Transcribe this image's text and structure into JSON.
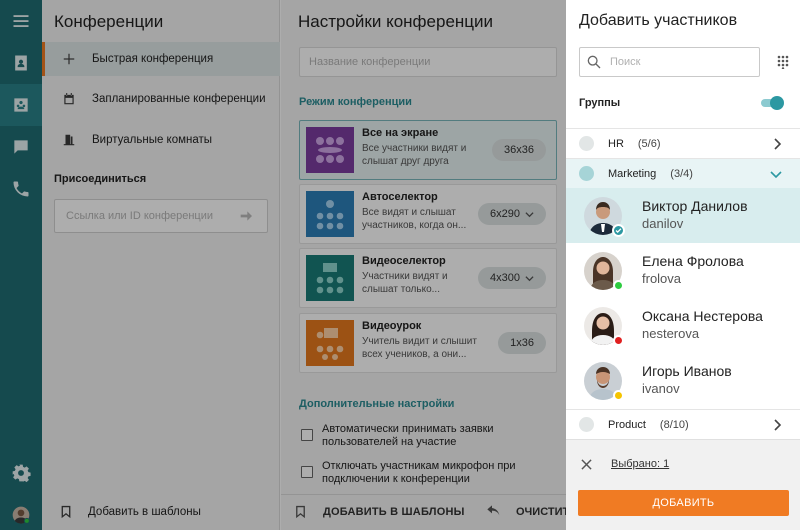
{
  "colors": {
    "rail": "#1f6d74",
    "accent_orange": "#f07b23",
    "teal": "#2c98a2",
    "online": "#2ecc40",
    "busy": "#e02020",
    "away": "#f5c400"
  },
  "rail": {
    "icons": [
      "menu-icon",
      "contacts-icon",
      "conference-icon",
      "chat-icon",
      "phone-icon",
      "settings-icon",
      "user-avatar"
    ]
  },
  "conferences": {
    "title": "Конференции",
    "items": [
      {
        "label": "Быстрая конференция",
        "icon": "plus-icon"
      },
      {
        "label": "Запланированные конференции",
        "icon": "calendar-icon"
      },
      {
        "label": "Виртуальные комнаты",
        "icon": "door-icon"
      }
    ],
    "join_label": "Присоединиться",
    "join_placeholder": "Ссылка или ID конференции",
    "footer_label": "Добавить в шаблоны"
  },
  "settings": {
    "title": "Настройки конференции",
    "name_placeholder": "Название конференции",
    "mode_label": "Режим конференции",
    "modes": [
      {
        "name": "Все на экране",
        "desc": "Все участники видят и слышат друг друга",
        "value": "36x36",
        "dropdown": false
      },
      {
        "name": "Автоселектор",
        "desc": "Все видят и слышат участников, когда он...",
        "value": "6x290",
        "dropdown": true
      },
      {
        "name": "Видеоселектор",
        "desc": "Участники видят и слышат только...",
        "value": "4x300",
        "dropdown": true
      },
      {
        "name": "Видеоурок",
        "desc": "Учитель видит и слышит всех учеников, а они...",
        "value": "1x36",
        "dropdown": false
      }
    ],
    "extra_label": "Дополнительные настройки",
    "options": [
      "Автоматически принимать заявки пользователей на участие",
      "Отключать участникам микрофон при подключении к конференции"
    ],
    "footer_add": "ДОБАВИТЬ В ШАБЛОНЫ",
    "footer_clear": "ОЧИСТИТЬ"
  },
  "dialog": {
    "title": "Добавить участников",
    "search_placeholder": "Поиск",
    "groups_label": "Группы",
    "groups_toggle": true,
    "groups": [
      {
        "name": "HR",
        "count": "(5/6)"
      },
      {
        "name": "Marketing",
        "count": "(3/4)"
      },
      {
        "name": "Product",
        "count": "(8/10)"
      }
    ],
    "people": [
      {
        "name": "Виктор Данилов",
        "login": "danilov",
        "status": "selected"
      },
      {
        "name": "Елена Фролова",
        "login": "frolova",
        "status": "online"
      },
      {
        "name": "Оксана Нестерова",
        "login": "nesterova",
        "status": "busy"
      },
      {
        "name": "Игорь Иванов",
        "login": "ivanov",
        "status": "away"
      }
    ],
    "selected_text": "Выбрано: 1",
    "add_button": "ДОБАВИТЬ"
  }
}
